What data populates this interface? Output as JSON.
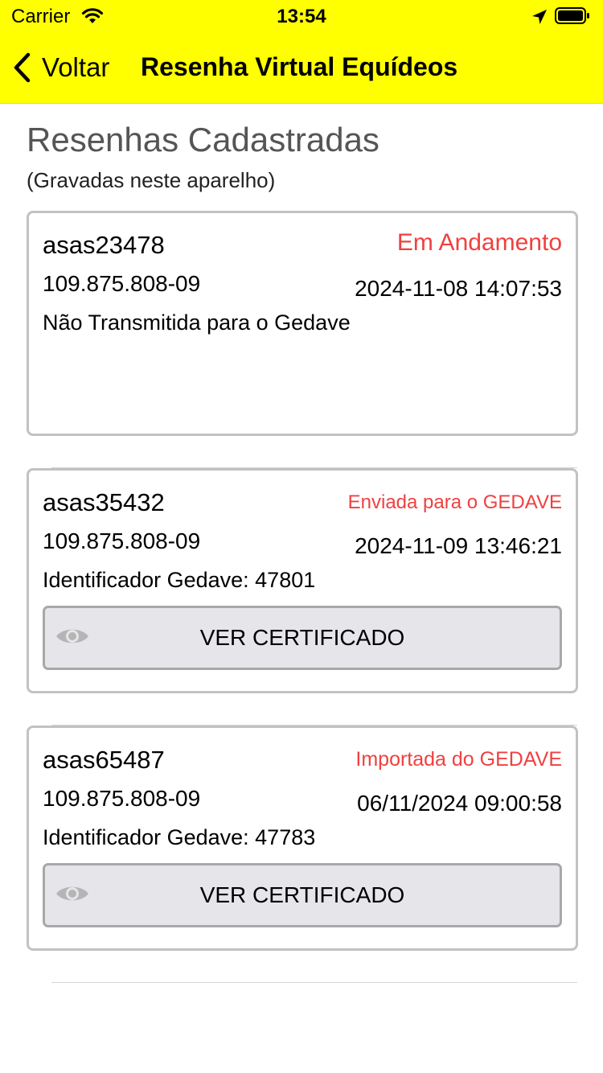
{
  "status_bar": {
    "carrier": "Carrier",
    "time": "13:54"
  },
  "nav": {
    "back_label": "Voltar",
    "title": "Resenha Virtual Equídeos"
  },
  "section": {
    "title": "Resenhas Cadastradas",
    "subtitle": "(Gravadas neste aparelho)"
  },
  "colors": {
    "header_bg": "#ffff00",
    "status_red": "#f04040",
    "button_bg": "#e5e5ea"
  },
  "cards": [
    {
      "code": "asas23478",
      "status": "Em Andamento",
      "cpf": "109.875.808-09",
      "date": "2024-11-08 14:07:53",
      "info": "Não Transmitida para o Gedave"
    },
    {
      "code": "asas35432",
      "status": "Enviada para o GEDAVE",
      "cpf": "109.875.808-09",
      "date": "2024-11-09 13:46:21",
      "info": "Identificador Gedave: 47801",
      "button_label": "VER CERTIFICADO",
      "button_icon": "eye-icon"
    },
    {
      "code": "asas65487",
      "status": "Importada do GEDAVE",
      "cpf": "109.875.808-09",
      "date": "06/11/2024 09:00:58",
      "info": "Identificador Gedave: 47783",
      "button_label": "VER CERTIFICADO",
      "button_icon": "eye-icon"
    }
  ]
}
